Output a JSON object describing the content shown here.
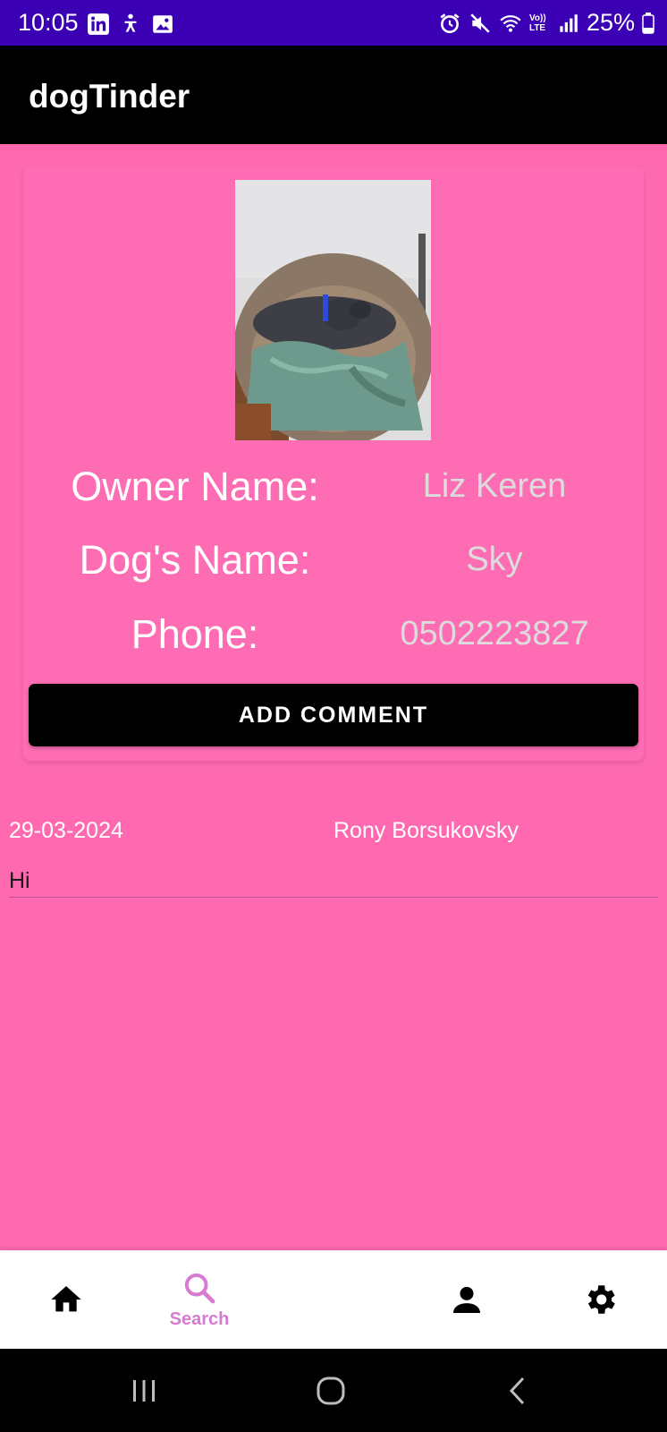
{
  "status_bar": {
    "time": "10:05",
    "left_icons": [
      "linkedin-icon",
      "accessibility-icon",
      "image-icon"
    ],
    "right_icons": [
      "alarm-icon",
      "mute-icon",
      "wifi-icon",
      "volte-icon",
      "signal-icon"
    ],
    "volte_text": "Vo)) LTE",
    "battery": "25%",
    "battery_icon": "battery-icon"
  },
  "app_bar": {
    "title": "dogTinder"
  },
  "dog_card": {
    "photo": "dog-photo",
    "owner_label": "Owner Name:",
    "owner_value": "Liz Keren",
    "dog_label": "Dog's Name:",
    "dog_value": "Sky",
    "phone_label": "Phone:",
    "phone_value": "0502223827",
    "add_comment_label": "ADD COMMENT"
  },
  "comments": [
    {
      "date": "29-03-2024",
      "author": "Rony Borsukovsky",
      "text": "Hi"
    }
  ],
  "bottom_nav": {
    "items": [
      {
        "icon": "home-icon",
        "label": ""
      },
      {
        "icon": "search-icon",
        "label": "Search"
      },
      {
        "icon": "person-icon",
        "label": ""
      },
      {
        "icon": "gear-icon",
        "label": ""
      }
    ],
    "active_color": "#d77ad2"
  },
  "system_nav": [
    "recents-icon",
    "home-circle-icon",
    "back-icon"
  ],
  "colors": {
    "background": "#ff69b0",
    "status_bar": "#3c00b4",
    "app_bar": "#000000",
    "value_text": "#dcdcdc"
  }
}
